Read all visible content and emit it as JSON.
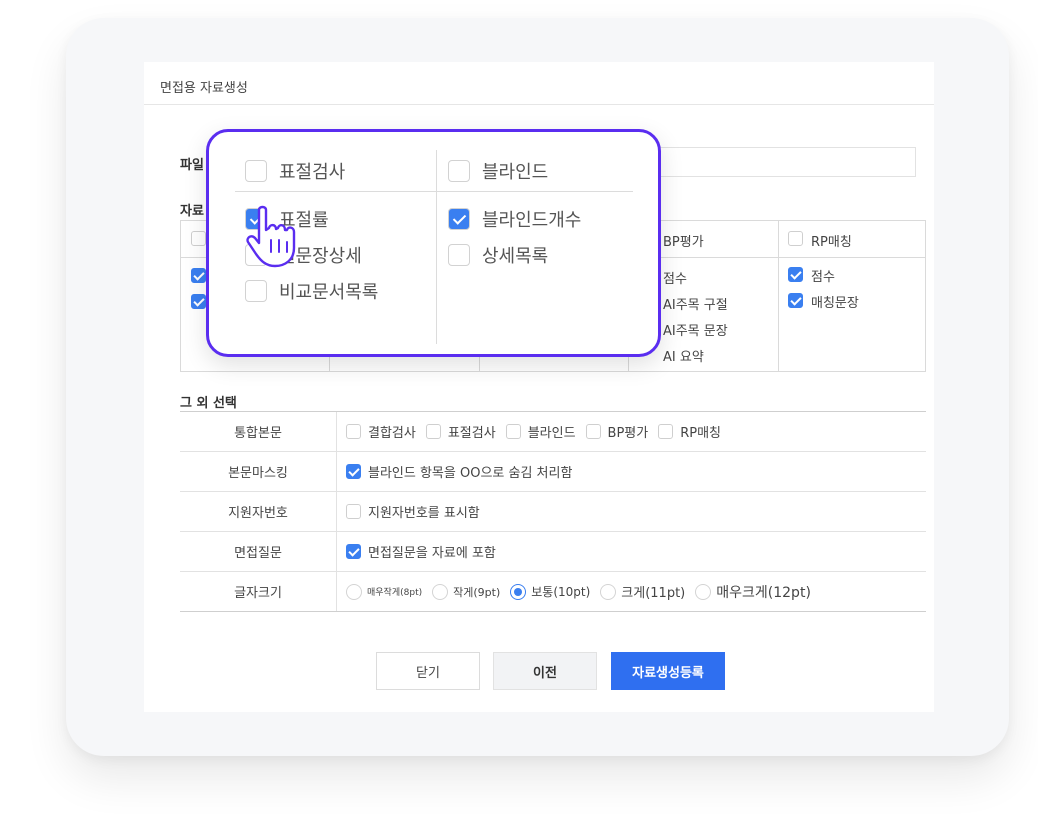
{
  "dialog": {
    "title": "면접용 자료생성",
    "file_label": "파일",
    "category_label": "자료"
  },
  "categories": {
    "bp": {
      "header": "BP평가",
      "items": [
        "점수",
        "AI주목 구절",
        "AI주목 문장",
        "AI 요약"
      ]
    },
    "rp": {
      "header": "RP매칭",
      "items": [
        {
          "label": "점수",
          "checked": true
        },
        {
          "label": "매칭문장",
          "checked": true
        }
      ]
    }
  },
  "popup": {
    "plagiarism": {
      "header": "표절검사",
      "items": [
        {
          "label": "표절률",
          "checked": true
        },
        {
          "label": "질문장상세",
          "checked": false
        },
        {
          "label": "비교문서목록",
          "checked": false
        }
      ]
    },
    "blind": {
      "header": "블라인드",
      "items": [
        {
          "label": "블라인드개수",
          "checked": true
        },
        {
          "label": "상세목록",
          "checked": false
        }
      ]
    }
  },
  "other": {
    "section_label": "그 외 선택",
    "rows": {
      "merged": {
        "label": "통합본문",
        "options": [
          "결합검사",
          "표절검사",
          "블라인드",
          "BP평가",
          "RP매칭"
        ]
      },
      "masking": {
        "label": "본문마스킹",
        "option": "블라인드 항목을 OO으로 숨김 처리함",
        "checked": true
      },
      "applicant_no": {
        "label": "지원자번호",
        "option": "지원자번호를 표시함",
        "checked": false
      },
      "interview_q": {
        "label": "면접질문",
        "option": "면접질문을 자료에 포함",
        "checked": true
      },
      "font_size": {
        "label": "글자크기",
        "options": [
          "매우작게(8pt)",
          "작게(9pt)",
          "보통(10pt)",
          "크게(11pt)",
          "매우크게(12pt)"
        ],
        "selected": "보통(10pt)"
      }
    }
  },
  "buttons": {
    "close": "닫기",
    "prev": "이전",
    "submit": "자료생성등록"
  },
  "colors": {
    "accent": "#2f6ff0",
    "checkbox": "#3a7ff0",
    "popup_border": "#5a2df0"
  }
}
